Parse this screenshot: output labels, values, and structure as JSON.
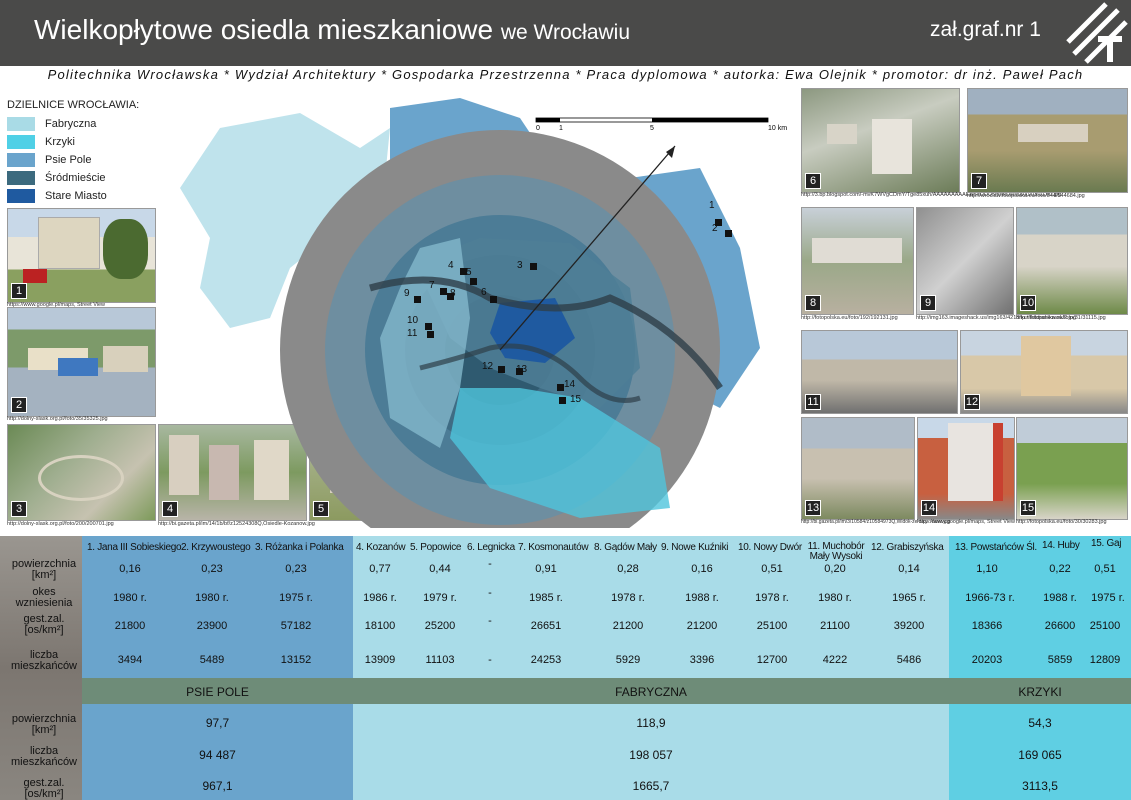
{
  "header": {
    "title_main": "Wielkopłytowe osiedla mieszkaniowe",
    "title_tail": "we Wrocławiu",
    "attachment": "zał.graf.nr 1"
  },
  "subtitle": "Politechnika Wrocławska * Wydział Architektury * Gospodarka Przestrzenna * Praca dyplomowa * autorka: Ewa Olejnik * promotor: dr inż. Paweł Pach",
  "legend": {
    "title": "DZIELNICE WROCŁAWIA:",
    "items": [
      {
        "label": "Fabryczna",
        "color": "#a9dbe6"
      },
      {
        "label": "Krzyki",
        "color": "#4fd0e6"
      },
      {
        "label": "Psie Pole",
        "color": "#6aa4cc"
      },
      {
        "label": "Śródmieście",
        "color": "#3c6a7e"
      },
      {
        "label": "Stare Miasto",
        "color": "#1f5aa0"
      }
    ]
  },
  "scale": {
    "t0": "0",
    "t1": "1",
    "t5": "5",
    "t10": "10 km"
  },
  "photos": {
    "p1": {
      "n": "1",
      "cap": "https://www.google.pl/maps, Street View"
    },
    "p2": {
      "n": "2",
      "cap": "http://dolny-slask.org.pl/foto/35/35325.jpg"
    },
    "p3": {
      "n": "3",
      "cap": "http://dolny-slask.org.pl/foto/200/200701.jpg"
    },
    "p4": {
      "n": "4",
      "cap": "http://bi.gazeta.pl/im/14/1b/bf/z12524308Q,Osiedle-Kozanow.jpg"
    },
    "p5": {
      "n": "5",
      "cap": ""
    },
    "p6": {
      "n": "6",
      "cap": "http://3.bp.blogspot.com/-mvK7WVgCDmY/Tge85xuh/AAAAAAAAAEk/5eDOU5mMoJs/s1600/03.01.00.jpg"
    },
    "p7": {
      "n": "7",
      "cap": "http://wroclaw.fotopolska.eu/foto/544/544684.jpg"
    },
    "p8": {
      "n": "8",
      "cap": "http://fotopolska.eu/foto/192/192131.jpg"
    },
    "p9": {
      "n": "9",
      "cap": "http://img163.imageshack.us/img163/4218/kunikitdrankowski2.jpg"
    },
    "p10": {
      "n": "10",
      "cap": "http://fotopolska.eu/foto/31/31115.jpg"
    },
    "p11": {
      "n": "11",
      "cap": ""
    },
    "p12": {
      "n": "12",
      "cap": ""
    },
    "p13": {
      "n": "13",
      "cap": "http://bi.gazeta.pl/im/3/10584/z10584973Q,Widok-ze-Sky-Tower.jpg"
    },
    "p14": {
      "n": "14",
      "cap": "https://www.google.pl/maps, Street View"
    },
    "p15": {
      "n": "15",
      "cap": "http://fotopolska.eu/foto/30/30283.jpg"
    }
  },
  "markers": [
    "1",
    "2",
    "3",
    "4",
    "5",
    "6",
    "7",
    "8",
    "9",
    "10",
    "11",
    "12",
    "13",
    "14",
    "15"
  ],
  "table": {
    "row_labels": [
      "powierzchnia [km²]",
      "okes wzniesienia",
      "gest.zal. [os/km²]",
      "liczba mieszkańców"
    ],
    "columns": [
      {
        "name": "1. Jana III Sobieskiego",
        "area": "0,16",
        "year": "1980 r.",
        "density": "21800",
        "pop": "3494"
      },
      {
        "name": "2. Krzywoustego",
        "area": "0,23",
        "year": "1980 r.",
        "density": "23900",
        "pop": "5489"
      },
      {
        "name": "3. Różanka i Polanka",
        "area": "0,23",
        "year": "1975 r.",
        "density": "57182",
        "pop": "13152"
      },
      {
        "name": "4. Kozanów",
        "area": "0,77",
        "year": "1986 r.",
        "density": "18100",
        "pop": "13909"
      },
      {
        "name": "5. Popowice",
        "area": "0,44",
        "year": "1979 r.",
        "density": "25200",
        "pop": "11103"
      },
      {
        "name": "6. Legnicka",
        "area": "-",
        "year": "-",
        "density": "-",
        "pop": "-"
      },
      {
        "name": "7. Kosmonautów",
        "area": "0,91",
        "year": "1985 r.",
        "density": "26651",
        "pop": "24253"
      },
      {
        "name": "8. Gądów Mały",
        "area": "0,28",
        "year": "1978 r.",
        "density": "21200",
        "pop": "5929"
      },
      {
        "name": "9. Nowe Kuźniki",
        "area": "0,16",
        "year": "1988 r.",
        "density": "21200",
        "pop": "3396"
      },
      {
        "name": "10. Nowy Dwór",
        "area": "0,51",
        "year": "1978 r.",
        "density": "25100",
        "pop": "12700"
      },
      {
        "name": "11. Muchobór Mały Wysoki",
        "area": "0,20",
        "year": "1980 r.",
        "density": "21100",
        "pop": "4222"
      },
      {
        "name": "12. Grabiszyńska",
        "area": "0,14",
        "year": "1965 r.",
        "density": "39200",
        "pop": "5486"
      },
      {
        "name": "13. Powstańców Śl.",
        "area": "1,10",
        "year": "1966-73 r.",
        "density": "18366",
        "pop": "20203"
      },
      {
        "name": "14. Huby",
        "area": "0,22",
        "year": "1988 r.",
        "density": "26600",
        "pop": "5859"
      },
      {
        "name": "15. Gaj",
        "area": "0,51",
        "year": "1975 r.",
        "density": "25100",
        "pop": "12809"
      }
    ],
    "district_labels": [
      "powierzchnia [km²]",
      "liczba mieszkańców",
      "gest.zal. [os/km²]"
    ],
    "districts": [
      {
        "name": "PSIE POLE",
        "area": "97,7",
        "pop": "94 487",
        "density": "967,1"
      },
      {
        "name": "FABRYCZNA",
        "area": "118,9",
        "pop": "198 057",
        "density": "1665,7"
      },
      {
        "name": "KRZYKI",
        "area": "54,3",
        "pop": "169 065",
        "density": "3113,5"
      }
    ]
  }
}
